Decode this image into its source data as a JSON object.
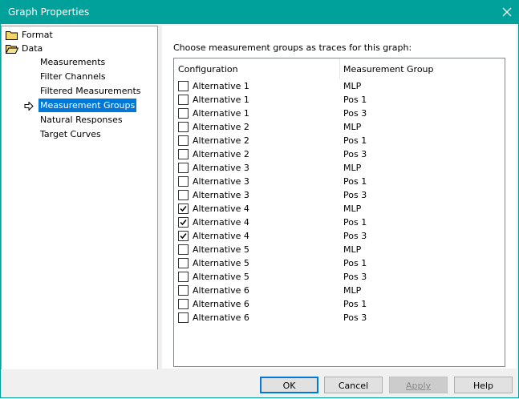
{
  "window": {
    "title": "Graph Properties"
  },
  "tree": {
    "format": "Format",
    "data": "Data",
    "children": [
      "Measurements",
      "Filter Channels",
      "Filtered Measurements",
      "Measurement Groups",
      "Natural Responses",
      "Target Curves"
    ],
    "selected": "Measurement Groups"
  },
  "panel": {
    "prompt": "Choose measurement groups as traces for this graph:",
    "columns": {
      "configuration": "Configuration",
      "group": "Measurement Group"
    },
    "rows": [
      {
        "configuration": "Alternative 1",
        "group": "MLP",
        "checked": false
      },
      {
        "configuration": "Alternative 1",
        "group": "Pos 1",
        "checked": false
      },
      {
        "configuration": "Alternative 1",
        "group": "Pos 3",
        "checked": false
      },
      {
        "configuration": "Alternative 2",
        "group": "MLP",
        "checked": false
      },
      {
        "configuration": "Alternative 2",
        "group": "Pos 1",
        "checked": false
      },
      {
        "configuration": "Alternative 2",
        "group": "Pos 3",
        "checked": false
      },
      {
        "configuration": "Alternative 3",
        "group": "MLP",
        "checked": false
      },
      {
        "configuration": "Alternative 3",
        "group": "Pos 1",
        "checked": false
      },
      {
        "configuration": "Alternative 3",
        "group": "Pos 3",
        "checked": false
      },
      {
        "configuration": "Alternative 4",
        "group": "MLP",
        "checked": true
      },
      {
        "configuration": "Alternative 4",
        "group": "Pos 1",
        "checked": true
      },
      {
        "configuration": "Alternative 4",
        "group": "Pos 3",
        "checked": true
      },
      {
        "configuration": "Alternative 5",
        "group": "MLP",
        "checked": false
      },
      {
        "configuration": "Alternative 5",
        "group": "Pos 1",
        "checked": false
      },
      {
        "configuration": "Alternative 5",
        "group": "Pos 3",
        "checked": false
      },
      {
        "configuration": "Alternative 6",
        "group": "MLP",
        "checked": false
      },
      {
        "configuration": "Alternative 6",
        "group": "Pos 1",
        "checked": false
      },
      {
        "configuration": "Alternative 6",
        "group": "Pos 3",
        "checked": false
      }
    ]
  },
  "buttons": {
    "ok": "OK",
    "cancel": "Cancel",
    "apply": "Apply",
    "help": "Help"
  },
  "colors": {
    "titlebar": "#00a19a",
    "selection": "#0078d7"
  }
}
